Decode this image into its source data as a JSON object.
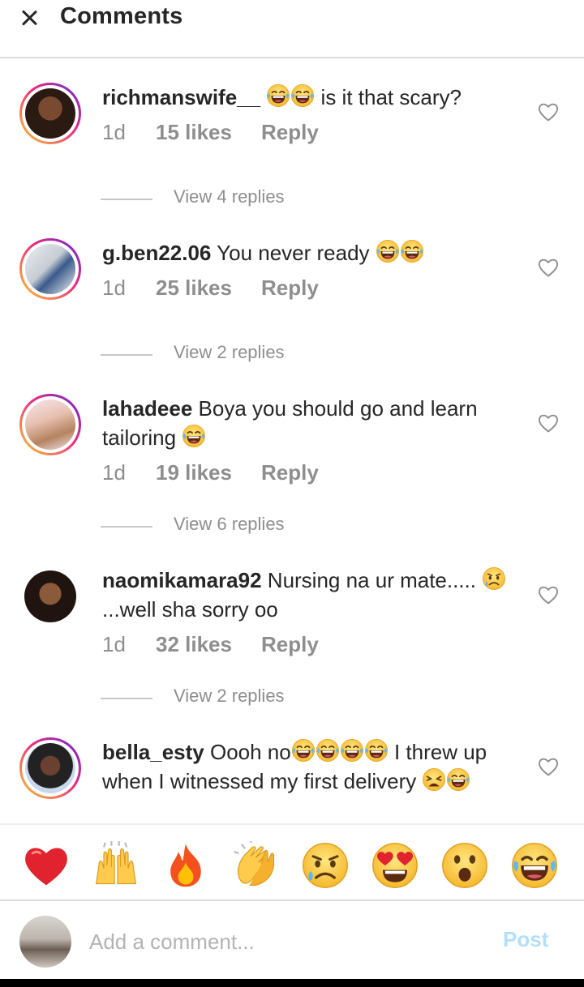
{
  "header": {
    "title": "Comments",
    "close_icon": "close-icon"
  },
  "comments": [
    {
      "username": "richmanswife__",
      "text_before": "",
      "emojis_before": [
        "laughing-tears",
        "laughing-tears"
      ],
      "text": " is it that scary?",
      "emojis_after": [],
      "time": "1d",
      "likes": "15 likes",
      "reply": "Reply",
      "view_replies": "View 4 replies"
    },
    {
      "username": "g.ben22.06",
      "text": " You never ready ",
      "emojis_after": [
        "laughing-tears",
        "laughing-tears"
      ],
      "time": "1d",
      "likes": "25 likes",
      "reply": "Reply",
      "view_replies": "View 2 replies"
    },
    {
      "username": "lahadeee",
      "text": " Boya you should go and learn tailoring ",
      "emojis_after": [
        "laughing-tears"
      ],
      "time": "1d",
      "likes": "19 likes",
      "reply": "Reply",
      "view_replies": "View 6 replies"
    },
    {
      "username": "naomikamara92",
      "text": " Nursing na ur mate..... ",
      "emojis_mid": [
        "sad-sweat"
      ],
      "text_after": "...well sha sorry oo",
      "time": "1d",
      "likes": "32 likes",
      "reply": "Reply",
      "view_replies": "View 2 replies"
    },
    {
      "username": "bella_esty",
      "text": " Oooh no",
      "emojis_mid": [
        "laughing-tears",
        "laughing-tears",
        "laughing-tears",
        "laughing-tears"
      ],
      "text_after": " I threw up when I witnessed my first delivery ",
      "emojis_after": [
        "weary",
        "laughing-tears"
      ]
    }
  ],
  "reactions": [
    "red-heart",
    "raising-hands",
    "fire",
    "clapping-hands",
    "sad-sweat",
    "heart-eyes",
    "surprised",
    "laughing-tears"
  ],
  "composer": {
    "placeholder": "Add a comment...",
    "post_label": "Post"
  },
  "colors": {
    "link_muted": "#8e8e8e",
    "post_disabled": "#b2dffc",
    "text": "#262626",
    "heart": "#e0232e"
  }
}
